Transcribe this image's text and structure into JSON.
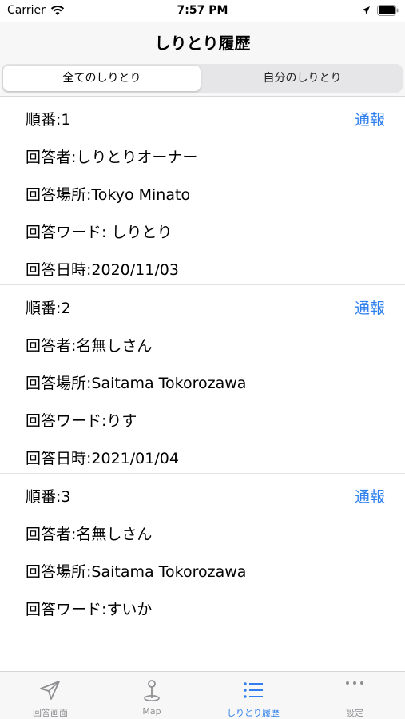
{
  "status_bar": {
    "carrier": "Carrier",
    "time": "7:57 PM"
  },
  "nav": {
    "title": "しりとり履歴"
  },
  "segments": {
    "all": "全てのしりとり",
    "mine": "自分のしりとり",
    "selected": "all"
  },
  "report_label": "通報",
  "entries": [
    {
      "number": "順番:1",
      "responder": "回答者:しりとりオーナー",
      "place": "回答場所:Tokyo  Minato",
      "word": "回答ワード: しりとり",
      "date": "回答日時:2020/11/03"
    },
    {
      "number": "順番:2",
      "responder": "回答者:名無しさん",
      "place": "回答場所:Saitama  Tokorozawa",
      "word": "回答ワード:りす",
      "date": "回答日時:2021/01/04"
    },
    {
      "number": "順番:3",
      "responder": "回答者:名無しさん",
      "place": "回答場所:Saitama  Tokorozawa",
      "word": "回答ワード:すいか"
    }
  ],
  "tabs": [
    {
      "label": "回答画面",
      "icon": "send-icon"
    },
    {
      "label": "Map",
      "icon": "map-pin-icon"
    },
    {
      "label": "しりとり履歴",
      "icon": "list-icon",
      "active": true
    },
    {
      "label": "設定",
      "icon": "more-icon"
    }
  ],
  "colors": {
    "accent": "#2f80ed",
    "inactive_tab": "#8e8e93",
    "bar_background": "#f7f7f7"
  }
}
